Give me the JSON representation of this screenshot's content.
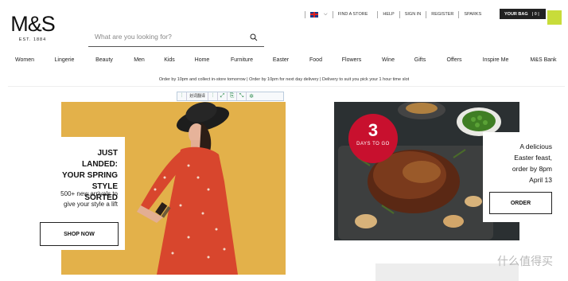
{
  "brand": {
    "logo": "M&S",
    "est": "EST. 1884"
  },
  "search": {
    "placeholder": "What are you looking for?"
  },
  "utility": {
    "find_store": "FIND A STORE",
    "help": "HELP",
    "sign_in": "SIGN IN",
    "register": "REGISTER",
    "sparks": "SPARKS",
    "bag_label": "YOUR BAG",
    "bag_count": "| 0 |"
  },
  "nav": {
    "items": [
      "Women",
      "Lingerie",
      "Beauty",
      "Men",
      "Kids",
      "Home",
      "Furniture",
      "Easter",
      "Food",
      "Flowers",
      "Wine",
      "Gifts",
      "Offers",
      "Inspire Me",
      "M&S Bank"
    ]
  },
  "promo": "Order by 10pm and collect in-store tomorrow  |  Order by 10pm for next day delivery  |  Delivery to suit you pick your 1 hour time slot",
  "toolbar": {
    "label": "划词翻译"
  },
  "hero_left": {
    "heading": [
      "JUST LANDED:",
      "YOUR SPRING",
      "STYLE SORTED"
    ],
    "sub": [
      "500+ new arrivals to",
      "give your style a lift"
    ],
    "cta": "SHOP NOW"
  },
  "hero_right": {
    "badge_number": "3",
    "badge_label": "DAYS TO GO",
    "text": [
      "A delicious",
      "Easter feast,",
      "order by 8pm",
      "April 13"
    ],
    "cta": "ORDER"
  },
  "watermark": "什么值得买",
  "colors": {
    "badge": "#c8102e",
    "hero_bg": "#e3b14a",
    "bag": "#222222",
    "bag_badge": "#c8dc3a"
  }
}
